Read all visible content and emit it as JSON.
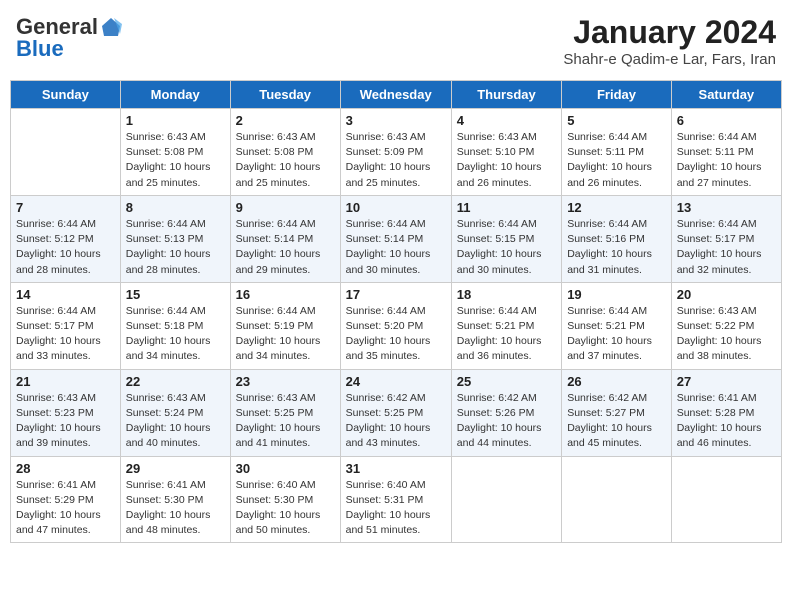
{
  "header": {
    "logo_general": "General",
    "logo_blue": "Blue",
    "month_title": "January 2024",
    "subtitle": "Shahr-e Qadim-e Lar, Fars, Iran"
  },
  "days_of_week": [
    "Sunday",
    "Monday",
    "Tuesday",
    "Wednesday",
    "Thursday",
    "Friday",
    "Saturday"
  ],
  "weeks": [
    [
      {
        "day": "",
        "info": ""
      },
      {
        "day": "1",
        "info": "Sunrise: 6:43 AM\nSunset: 5:08 PM\nDaylight: 10 hours\nand 25 minutes."
      },
      {
        "day": "2",
        "info": "Sunrise: 6:43 AM\nSunset: 5:08 PM\nDaylight: 10 hours\nand 25 minutes."
      },
      {
        "day": "3",
        "info": "Sunrise: 6:43 AM\nSunset: 5:09 PM\nDaylight: 10 hours\nand 25 minutes."
      },
      {
        "day": "4",
        "info": "Sunrise: 6:43 AM\nSunset: 5:10 PM\nDaylight: 10 hours\nand 26 minutes."
      },
      {
        "day": "5",
        "info": "Sunrise: 6:44 AM\nSunset: 5:11 PM\nDaylight: 10 hours\nand 26 minutes."
      },
      {
        "day": "6",
        "info": "Sunrise: 6:44 AM\nSunset: 5:11 PM\nDaylight: 10 hours\nand 27 minutes."
      }
    ],
    [
      {
        "day": "7",
        "info": "Sunrise: 6:44 AM\nSunset: 5:12 PM\nDaylight: 10 hours\nand 28 minutes."
      },
      {
        "day": "8",
        "info": "Sunrise: 6:44 AM\nSunset: 5:13 PM\nDaylight: 10 hours\nand 28 minutes."
      },
      {
        "day": "9",
        "info": "Sunrise: 6:44 AM\nSunset: 5:14 PM\nDaylight: 10 hours\nand 29 minutes."
      },
      {
        "day": "10",
        "info": "Sunrise: 6:44 AM\nSunset: 5:14 PM\nDaylight: 10 hours\nand 30 minutes."
      },
      {
        "day": "11",
        "info": "Sunrise: 6:44 AM\nSunset: 5:15 PM\nDaylight: 10 hours\nand 30 minutes."
      },
      {
        "day": "12",
        "info": "Sunrise: 6:44 AM\nSunset: 5:16 PM\nDaylight: 10 hours\nand 31 minutes."
      },
      {
        "day": "13",
        "info": "Sunrise: 6:44 AM\nSunset: 5:17 PM\nDaylight: 10 hours\nand 32 minutes."
      }
    ],
    [
      {
        "day": "14",
        "info": "Sunrise: 6:44 AM\nSunset: 5:17 PM\nDaylight: 10 hours\nand 33 minutes."
      },
      {
        "day": "15",
        "info": "Sunrise: 6:44 AM\nSunset: 5:18 PM\nDaylight: 10 hours\nand 34 minutes."
      },
      {
        "day": "16",
        "info": "Sunrise: 6:44 AM\nSunset: 5:19 PM\nDaylight: 10 hours\nand 34 minutes."
      },
      {
        "day": "17",
        "info": "Sunrise: 6:44 AM\nSunset: 5:20 PM\nDaylight: 10 hours\nand 35 minutes."
      },
      {
        "day": "18",
        "info": "Sunrise: 6:44 AM\nSunset: 5:21 PM\nDaylight: 10 hours\nand 36 minutes."
      },
      {
        "day": "19",
        "info": "Sunrise: 6:44 AM\nSunset: 5:21 PM\nDaylight: 10 hours\nand 37 minutes."
      },
      {
        "day": "20",
        "info": "Sunrise: 6:43 AM\nSunset: 5:22 PM\nDaylight: 10 hours\nand 38 minutes."
      }
    ],
    [
      {
        "day": "21",
        "info": "Sunrise: 6:43 AM\nSunset: 5:23 PM\nDaylight: 10 hours\nand 39 minutes."
      },
      {
        "day": "22",
        "info": "Sunrise: 6:43 AM\nSunset: 5:24 PM\nDaylight: 10 hours\nand 40 minutes."
      },
      {
        "day": "23",
        "info": "Sunrise: 6:43 AM\nSunset: 5:25 PM\nDaylight: 10 hours\nand 41 minutes."
      },
      {
        "day": "24",
        "info": "Sunrise: 6:42 AM\nSunset: 5:25 PM\nDaylight: 10 hours\nand 43 minutes."
      },
      {
        "day": "25",
        "info": "Sunrise: 6:42 AM\nSunset: 5:26 PM\nDaylight: 10 hours\nand 44 minutes."
      },
      {
        "day": "26",
        "info": "Sunrise: 6:42 AM\nSunset: 5:27 PM\nDaylight: 10 hours\nand 45 minutes."
      },
      {
        "day": "27",
        "info": "Sunrise: 6:41 AM\nSunset: 5:28 PM\nDaylight: 10 hours\nand 46 minutes."
      }
    ],
    [
      {
        "day": "28",
        "info": "Sunrise: 6:41 AM\nSunset: 5:29 PM\nDaylight: 10 hours\nand 47 minutes."
      },
      {
        "day": "29",
        "info": "Sunrise: 6:41 AM\nSunset: 5:30 PM\nDaylight: 10 hours\nand 48 minutes."
      },
      {
        "day": "30",
        "info": "Sunrise: 6:40 AM\nSunset: 5:30 PM\nDaylight: 10 hours\nand 50 minutes."
      },
      {
        "day": "31",
        "info": "Sunrise: 6:40 AM\nSunset: 5:31 PM\nDaylight: 10 hours\nand 51 minutes."
      },
      {
        "day": "",
        "info": ""
      },
      {
        "day": "",
        "info": ""
      },
      {
        "day": "",
        "info": ""
      }
    ]
  ]
}
